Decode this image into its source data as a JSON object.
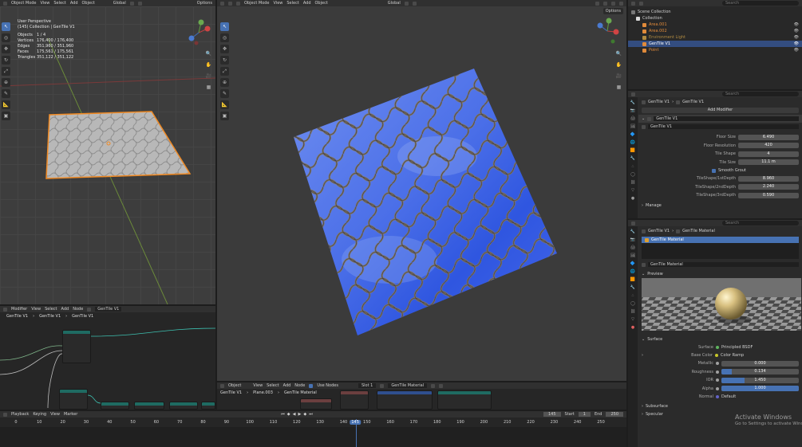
{
  "left_viewport": {
    "mode": "Object Mode",
    "menus": [
      "View",
      "Select",
      "Add",
      "Object"
    ],
    "transform": "Global",
    "options": "Options",
    "view_name": "User Perspective",
    "collection_line": "(145) Collection | GenTile V1",
    "stats": [
      {
        "label": "Objects",
        "value": "1 / 4"
      },
      {
        "label": "Vertices",
        "value": "176,400 / 176,400"
      },
      {
        "label": "Edges",
        "value": "351,960 / 351,960"
      },
      {
        "label": "Faces",
        "value": "175,561 / 175,561"
      },
      {
        "label": "Triangles",
        "value": "351,122 / 351,122"
      }
    ]
  },
  "center_viewport": {
    "mode": "Object Mode",
    "menus": [
      "View",
      "Select",
      "Add",
      "Object"
    ],
    "transform": "Global",
    "options": "Options"
  },
  "left_node_editor": {
    "type": "Modifier",
    "menus": [
      "View",
      "Select",
      "Add",
      "Node"
    ],
    "tree_name": "GenTile V1",
    "breadcrumb": [
      "GenTile V1",
      "GenTile V1",
      "GenTile V1"
    ]
  },
  "shader_editor": {
    "type": "Object",
    "menus": [
      "View",
      "Select",
      "Add",
      "Node"
    ],
    "use_nodes": "Use Nodes",
    "slot": "Slot 1",
    "material": "GenTile Material",
    "breadcrumb": [
      "GenTile V1",
      "Plane.003",
      "GenTile Material"
    ]
  },
  "outliner": {
    "search_placeholder": "Search",
    "scene": "Scene Collection",
    "collection": "Collection",
    "items": [
      {
        "name": "Area.001",
        "color": "#e08a3a"
      },
      {
        "name": "Area.002",
        "color": "#e08a3a"
      },
      {
        "name": "Environment Light",
        "color": "#b08a40"
      },
      {
        "name": "GenTile V1",
        "color": "#e08a3a",
        "selected": true
      },
      {
        "name": "Point",
        "color": "#e08a3a"
      }
    ]
  },
  "modifier_panel": {
    "breadcrumb": [
      "GenTile V1",
      "GenTile V1"
    ],
    "add_modifier": "Add Modifier",
    "modifier_name": "GenTile V1",
    "node_group": "GenTile V1",
    "props": [
      {
        "label": "Floor Size",
        "value": "6.490"
      },
      {
        "label": "Floor Resolution",
        "value": "420"
      },
      {
        "label": "Tile Shape",
        "value": "4"
      },
      {
        "label": "Tile Size",
        "value": "11.1 m"
      }
    ],
    "smooth_grout": "Smooth Grout",
    "depths": [
      {
        "label": "TileShape/1stDepth",
        "value": "8.960"
      },
      {
        "label": "TileShape/2ndDepth",
        "value": "2.240"
      },
      {
        "label": "TileShape/3rdDepth",
        "value": "0.590"
      }
    ],
    "manage": "Manage"
  },
  "material_panel": {
    "breadcrumb": [
      "GenTile V1",
      "GenTile Material"
    ],
    "slot_item": "GenTile Material",
    "material_name": "GenTile Material",
    "preview": "Preview",
    "surface_section": "Surface",
    "surface_label": "Surface",
    "surface_value": "Principled BSDF",
    "base_color_label": "Base Color",
    "base_color_value": "Color Ramp",
    "sliders": [
      {
        "label": "Metallic",
        "value": "0.000",
        "fill": 0.0
      },
      {
        "label": "Roughness",
        "value": "0.134",
        "fill": 0.134
      },
      {
        "label": "IOR",
        "value": "1.450",
        "fill": 0.3
      },
      {
        "label": "Alpha",
        "value": "1.000",
        "fill": 1.0
      }
    ],
    "normal_label": "Normal",
    "normal_value": "Default",
    "subsurface": "Subsurface",
    "specular": "Specular"
  },
  "timeline": {
    "menus": [
      "Playback",
      "Keying",
      "View",
      "Marker"
    ],
    "current_frame": "145",
    "start_label": "Start",
    "start": "1",
    "end_label": "End",
    "end": "250",
    "ticks": [
      "0",
      "10",
      "20",
      "30",
      "40",
      "50",
      "60",
      "70",
      "80",
      "90",
      "100",
      "110",
      "120",
      "130",
      "140",
      "145",
      "150",
      "160",
      "170",
      "180",
      "190",
      "200",
      "210",
      "220",
      "230",
      "240",
      "250"
    ]
  },
  "watermark": {
    "line1": "Activate Windows",
    "line2": "Go to Settings to activate Windows."
  }
}
